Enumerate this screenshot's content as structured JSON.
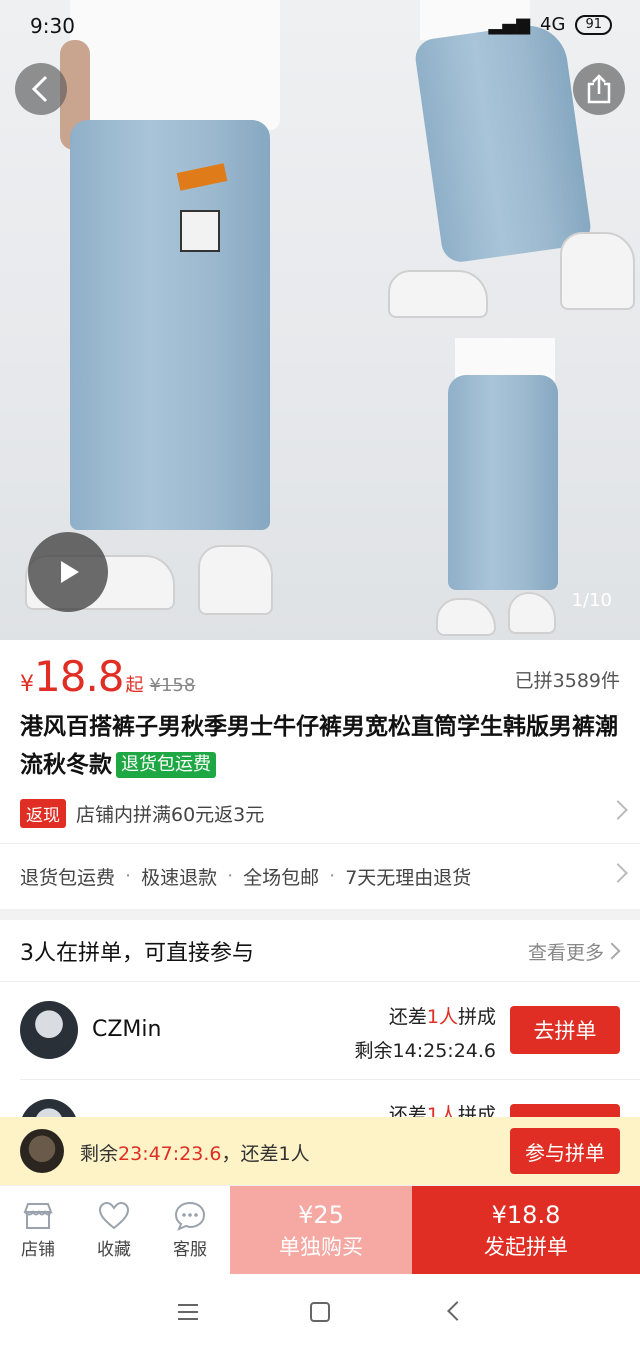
{
  "status_bar": {
    "time": "9:30",
    "network": "4G",
    "battery": "91"
  },
  "hero": {
    "image_counter": "1/10"
  },
  "price": {
    "currency": "¥",
    "value": "18.8",
    "suffix": "起",
    "original": "¥158",
    "sold": "已拼3589件"
  },
  "product": {
    "title": "港风百搭裤子男秋季男士牛仔裤男宽松直筒学生韩版男裤潮流秋冬款",
    "badge": "退货包运费"
  },
  "promo": {
    "tag": "返现",
    "text": "店铺内拼满60元返3元"
  },
  "guarantees": [
    "退货包运费",
    "极速退款",
    "全场包邮",
    "7天无理由退货"
  ],
  "groups": {
    "header": "3人在拼单，可直接参与",
    "more": "查看更多",
    "items": [
      {
        "name": "CZMin",
        "need_prefix": "还差",
        "need_count": "1人",
        "need_suffix": "拼成",
        "left_label": "剩余",
        "left_time": "14:25:24.6",
        "button": "去拼单"
      },
      {
        "name": "",
        "need_prefix": "还差",
        "need_count": "1人",
        "need_suffix": "拼成",
        "left_label": "",
        "left_time": "",
        "button": ""
      }
    ]
  },
  "float_bar": {
    "prefix": "剩余",
    "time": "23:47:23.6",
    "suffix": "，还差1人",
    "button": "参与拼单"
  },
  "action_bar": {
    "store": "店铺",
    "favorite": "收藏",
    "service": "客服",
    "alone_price": "¥25",
    "alone_label": "单独购买",
    "group_price": "¥18.8",
    "group_label": "发起拼单"
  },
  "colors": {
    "accent": "#e02e24",
    "badge_green": "#1ea844",
    "float_bg": "#fdf3c7"
  }
}
